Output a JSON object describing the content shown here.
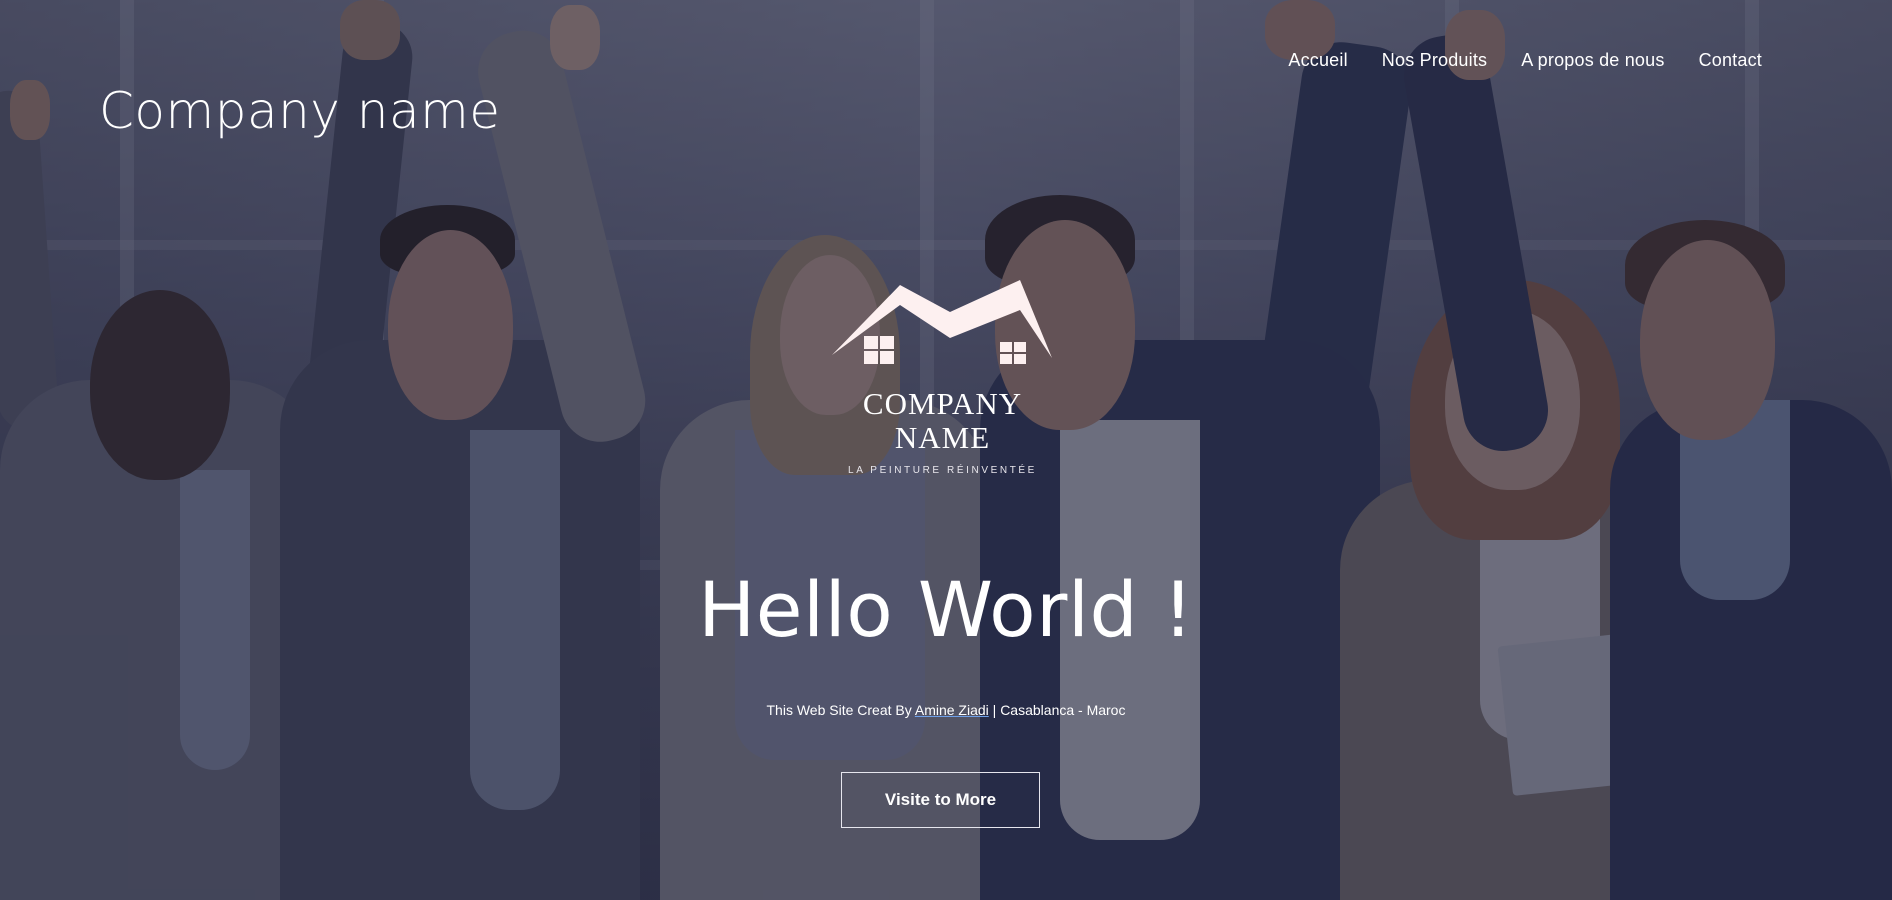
{
  "brand": {
    "name": "Company name"
  },
  "nav": {
    "items": [
      {
        "label": "Accueil"
      },
      {
        "label": "Nos Produits"
      },
      {
        "label": "A propos de nous"
      },
      {
        "label": "Contact"
      }
    ]
  },
  "logo": {
    "line1": "COMPANY",
    "line2": "NAME",
    "tagline": "LA PEINTURE RÉINVENTÉE"
  },
  "hero": {
    "title": "Hello World !",
    "credit_prefix": "This Web Site Creat By ",
    "credit_author": "Amine Ziadi",
    "credit_suffix": " | Casablanca - Maroc",
    "cta_label": "Visite to More",
    "background": "office-team-celebrating-photo"
  },
  "colors": {
    "overlay": "#22243c",
    "text": "#ffffff",
    "logo_fill": "#fdf0f0",
    "link_underline": "#6fa0e8"
  }
}
